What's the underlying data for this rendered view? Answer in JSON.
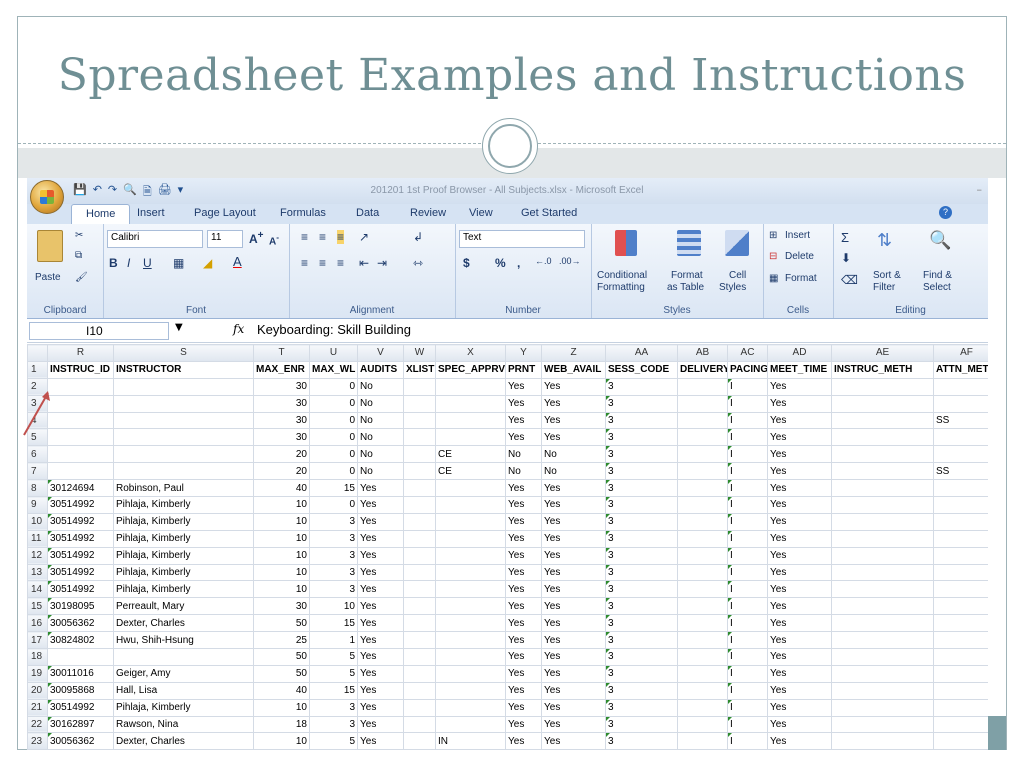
{
  "slide": {
    "title": "Spreadsheet Examples and Instructions"
  },
  "excel": {
    "window_title": "201201 1st Proof Browser - All Subjects.xlsx - Microsoft Excel",
    "tabs": [
      "Home",
      "Insert",
      "Page Layout",
      "Formulas",
      "Data",
      "Review",
      "View",
      "Get Started"
    ],
    "ribbon": {
      "clipboard": {
        "label": "Clipboard",
        "paste": "Paste"
      },
      "font": {
        "label": "Font",
        "name": "Calibri",
        "size": "11"
      },
      "alignment": {
        "label": "Alignment"
      },
      "number": {
        "label": "Number",
        "format": "Text"
      },
      "styles": {
        "label": "Styles",
        "conditional": "Conditional",
        "formatting": "Formatting",
        "format": "Format",
        "as_table": "as Table",
        "cell": "Cell",
        "cell_styles": "Styles"
      },
      "cells": {
        "label": "Cells",
        "insert": "Insert",
        "delete": "Delete",
        "format": "Format"
      },
      "editing": {
        "label": "Editing",
        "sort": "Sort &",
        "filter": "Filter",
        "find": "Find &",
        "select": "Select"
      }
    },
    "name_box": "I10",
    "formula": "Keyboarding: Skill Building",
    "columns": [
      "R",
      "S",
      "T",
      "U",
      "V",
      "W",
      "X",
      "Y",
      "Z",
      "AA",
      "AB",
      "AC",
      "AD",
      "AE",
      "AF"
    ],
    "headers": [
      "INSTRUC_ID",
      "INSTRUCTOR",
      "MAX_ENR",
      "MAX_WL",
      "AUDITS",
      "XLIST",
      "SPEC_APPRV",
      "PRNT",
      "WEB_AVAIL",
      "SESS_CODE",
      "DELIVERY",
      "PACING",
      "MEET_TIME",
      "INSTRUC_METH",
      "ATTN_METH"
    ],
    "rows": [
      [
        "",
        "",
        "30",
        "0",
        "No",
        "",
        "",
        "Yes",
        "Yes",
        "3",
        "",
        "I",
        "Yes",
        "",
        ""
      ],
      [
        "",
        "",
        "30",
        "0",
        "No",
        "",
        "",
        "Yes",
        "Yes",
        "3",
        "",
        "I",
        "Yes",
        "",
        ""
      ],
      [
        "",
        "",
        "30",
        "0",
        "No",
        "",
        "",
        "Yes",
        "Yes",
        "3",
        "",
        "I",
        "Yes",
        "",
        "SS"
      ],
      [
        "",
        "",
        "30",
        "0",
        "No",
        "",
        "",
        "Yes",
        "Yes",
        "3",
        "",
        "I",
        "Yes",
        "",
        ""
      ],
      [
        "",
        "",
        "20",
        "0",
        "No",
        "",
        "CE",
        "No",
        "No",
        "3",
        "",
        "I",
        "Yes",
        "",
        ""
      ],
      [
        "",
        "",
        "20",
        "0",
        "No",
        "",
        "CE",
        "No",
        "No",
        "3",
        "",
        "I",
        "Yes",
        "",
        "SS"
      ],
      [
        "30124694",
        "Robinson, Paul",
        "40",
        "15",
        "Yes",
        "",
        "",
        "Yes",
        "Yes",
        "3",
        "",
        "I",
        "Yes",
        "",
        ""
      ],
      [
        "30514992",
        "Pihlaja, Kimberly",
        "10",
        "0",
        "Yes",
        "",
        "",
        "Yes",
        "Yes",
        "3",
        "",
        "I",
        "Yes",
        "",
        ""
      ],
      [
        "30514992",
        "Pihlaja, Kimberly",
        "10",
        "3",
        "Yes",
        "",
        "",
        "Yes",
        "Yes",
        "3",
        "",
        "I",
        "Yes",
        "",
        ""
      ],
      [
        "30514992",
        "Pihlaja, Kimberly",
        "10",
        "3",
        "Yes",
        "",
        "",
        "Yes",
        "Yes",
        "3",
        "",
        "I",
        "Yes",
        "",
        ""
      ],
      [
        "30514992",
        "Pihlaja, Kimberly",
        "10",
        "3",
        "Yes",
        "",
        "",
        "Yes",
        "Yes",
        "3",
        "",
        "I",
        "Yes",
        "",
        ""
      ],
      [
        "30514992",
        "Pihlaja, Kimberly",
        "10",
        "3",
        "Yes",
        "",
        "",
        "Yes",
        "Yes",
        "3",
        "",
        "I",
        "Yes",
        "",
        ""
      ],
      [
        "30514992",
        "Pihlaja, Kimberly",
        "10",
        "3",
        "Yes",
        "",
        "",
        "Yes",
        "Yes",
        "3",
        "",
        "I",
        "Yes",
        "",
        ""
      ],
      [
        "30198095",
        "Perreault, Mary",
        "30",
        "10",
        "Yes",
        "",
        "",
        "Yes",
        "Yes",
        "3",
        "",
        "I",
        "Yes",
        "",
        ""
      ],
      [
        "30056362",
        "Dexter, Charles",
        "50",
        "15",
        "Yes",
        "",
        "",
        "Yes",
        "Yes",
        "3",
        "",
        "I",
        "Yes",
        "",
        ""
      ],
      [
        "30824802",
        "Hwu, Shih-Hsung",
        "25",
        "1",
        "Yes",
        "",
        "",
        "Yes",
        "Yes",
        "3",
        "",
        "I",
        "Yes",
        "",
        ""
      ],
      [
        "",
        "",
        "50",
        "5",
        "Yes",
        "",
        "",
        "Yes",
        "Yes",
        "3",
        "",
        "I",
        "Yes",
        "",
        ""
      ],
      [
        "30011016",
        "Geiger, Amy",
        "50",
        "5",
        "Yes",
        "",
        "",
        "Yes",
        "Yes",
        "3",
        "",
        "I",
        "Yes",
        "",
        ""
      ],
      [
        "30095868",
        "Hall, Lisa",
        "40",
        "15",
        "Yes",
        "",
        "",
        "Yes",
        "Yes",
        "3",
        "",
        "I",
        "Yes",
        "",
        ""
      ],
      [
        "30514992",
        "Pihlaja, Kimberly",
        "10",
        "3",
        "Yes",
        "",
        "",
        "Yes",
        "Yes",
        "3",
        "",
        "I",
        "Yes",
        "",
        ""
      ],
      [
        "30162897",
        "Rawson, Nina",
        "18",
        "3",
        "Yes",
        "",
        "",
        "Yes",
        "Yes",
        "3",
        "",
        "I",
        "Yes",
        "",
        ""
      ],
      [
        "30056362",
        "Dexter, Charles",
        "10",
        "5",
        "Yes",
        "",
        "IN",
        "Yes",
        "Yes",
        "3",
        "",
        "I",
        "Yes",
        "",
        ""
      ]
    ]
  }
}
